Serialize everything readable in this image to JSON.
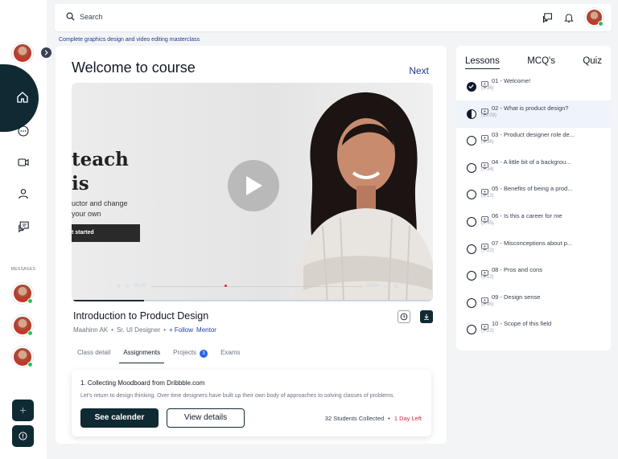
{
  "topbar": {
    "search_placeholder": "Search"
  },
  "breadcrumb": "Complete graphics design and video editing masterclass",
  "main": {
    "welcome": "Welcome to course",
    "next": "Next",
    "video": {
      "headline_1": "teach",
      "headline_2": "is",
      "subtext_1": "uctor and change",
      "subtext_2": "your own",
      "cta": "t started",
      "time_current": "00:00",
      "time_total": "05:56",
      "progress": 0.2
    },
    "course_title": "Introduction to Product Design",
    "instructor": "Maahinn AK",
    "instructor_role": "Sr. UI Designer",
    "follow": "+ Follow",
    "mentor": "Mentor",
    "tabs": [
      {
        "label": "Class detail"
      },
      {
        "label": "Assignments"
      },
      {
        "label": "Projects",
        "badge": "3"
      },
      {
        "label": "Exams"
      }
    ],
    "assignment": {
      "title": "1. Collecting Moodboard from Dribbble.com",
      "description": "Let's return to design thinking. Over time designers have built up their own body of approaches to solving classes of problems.",
      "btn_calendar": "See calender",
      "btn_details": "View details",
      "students": "32 Students Collected",
      "deadline": "1 Day Left"
    }
  },
  "rail": {
    "messages_label": "MESSAGES"
  },
  "side": {
    "tabs": [
      "Lessons",
      "MCQ's",
      "Quiz"
    ],
    "lessons": [
      {
        "title": "01 - Welcome!",
        "duration": "(3:36)",
        "state": "done"
      },
      {
        "title": "02 - What is product design?",
        "duration": "(13:09)",
        "state": "current"
      },
      {
        "title": "03 - Product designer role de...",
        "duration": "(3:36)",
        "state": "todo"
      },
      {
        "title": "04 - A little bit of a backgrou...",
        "duration": "(7:34)",
        "state": "todo"
      },
      {
        "title": "05 - Benefits of being a prod...",
        "duration": "(5:12)",
        "state": "todo"
      },
      {
        "title": "06 - Is this a career for me",
        "duration": "(8:45)",
        "state": "todo"
      },
      {
        "title": "07 - Misconceptions about p...",
        "duration": "(7:22)",
        "state": "todo"
      },
      {
        "title": "08 - Pros and cons",
        "duration": "(5:12)",
        "state": "todo"
      },
      {
        "title": "09 - Design sense",
        "duration": "(8:45)",
        "state": "todo"
      },
      {
        "title": "10 - Scope of this field",
        "duration": "(7:22)",
        "state": "todo"
      }
    ]
  },
  "colors": {
    "primary": "#0f2a33",
    "accent": "#1e40af",
    "danger": "#e11d48",
    "badge": "#2563eb"
  }
}
